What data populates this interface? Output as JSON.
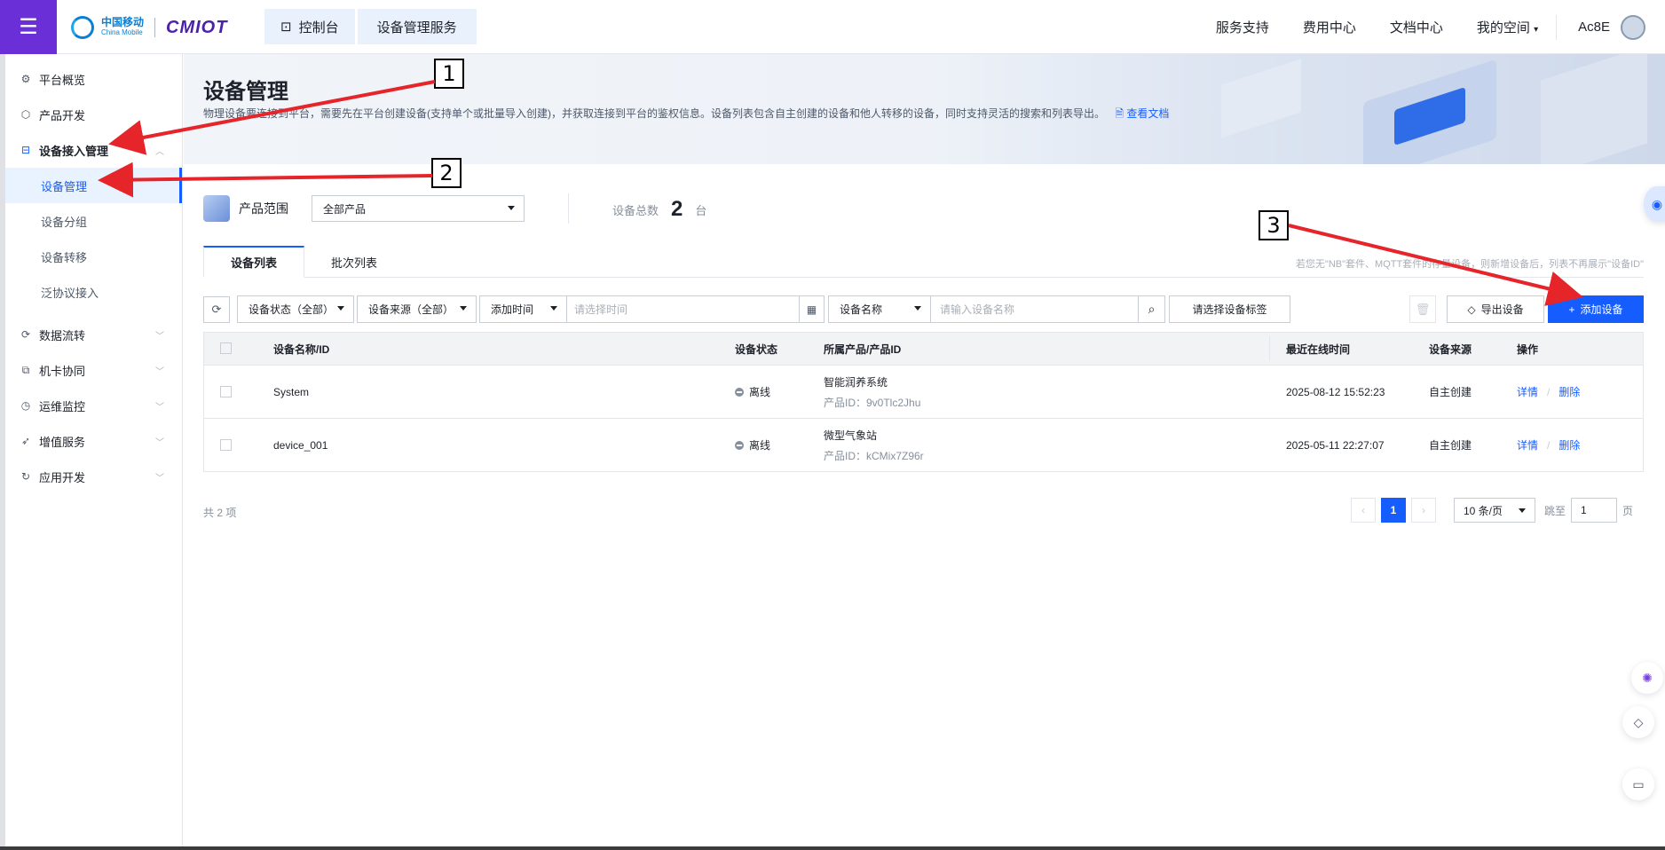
{
  "topbar": {
    "menu_icon": "menu-icon",
    "logo": {
      "brand_cn": "中国移动",
      "brand_en": "China Mobile",
      "product": "CMIOT"
    },
    "breadcrumbs": [
      "控制台",
      "设备管理服务"
    ],
    "links": [
      "服务支持",
      "费用中心",
      "文档中心",
      "我的空间"
    ],
    "user_name": "Ac8E"
  },
  "sidebar": {
    "items": [
      {
        "label": "平台概览",
        "icon": "overview-icon"
      },
      {
        "label": "产品开发",
        "icon": "cube-icon"
      },
      {
        "label": "设备接入管理",
        "icon": "device-access-icon"
      }
    ],
    "sub_items": [
      "设备管理",
      "设备分组",
      "设备转移",
      "泛协议接入"
    ],
    "groups": [
      {
        "label": "数据流转",
        "icon": "data-flow-icon"
      },
      {
        "label": "机卡协同",
        "icon": "sim-icon"
      },
      {
        "label": "运维监控",
        "icon": "monitor-icon"
      },
      {
        "label": "增值服务",
        "icon": "value-added-icon"
      },
      {
        "label": "应用开发",
        "icon": "app-dev-icon"
      }
    ]
  },
  "main": {
    "title": "设备管理",
    "description": "物理设备要连接到平台，需要先在平台创建设备(支持单个或批量导入创建)，并获取连接到平台的鉴权信息。设备列表包含自主创建的设备和他人转移的设备，同时支持灵活的搜索和列表导出。",
    "doc_link": "查看文档",
    "scope_label": "产品范围",
    "scope_value": "全部产品",
    "count_label": "设备总数",
    "count_value": "2",
    "count_unit": "台",
    "tabs": [
      "设备列表",
      "批次列表"
    ],
    "tab_hint": "若您无\"NB\"套件、MQTT套件的存量设备，则新增设备后，列表不再展示\"设备ID\"",
    "filters": {
      "status": "设备状态（全部）",
      "source": "设备来源（全部）",
      "time_type": "添加时间",
      "time_placeholder": "请选择时间",
      "name_type": "设备名称",
      "name_placeholder": "请输入设备名称",
      "tag_button": "请选择设备标签",
      "export_button": "导出设备",
      "add_button": "添加设备"
    },
    "table": {
      "columns": [
        "设备名称/ID",
        "设备状态",
        "所属产品/产品ID",
        "最近在线时间",
        "设备来源",
        "操作"
      ],
      "rows": [
        {
          "name": "System",
          "status": "离线",
          "product": "智能润养系统",
          "product_id": "产品ID：9v0Tlc2Jhu",
          "last_online": "2025-08-12 15:52:23",
          "source": "自主创建",
          "detail": "详情",
          "delete": "删除"
        },
        {
          "name": "device_001",
          "status": "离线",
          "product": "微型气象站",
          "product_id": "产品ID：kCMix7Z96r",
          "last_online": "2025-05-11 22:27:07",
          "source": "自主创建",
          "detail": "详情",
          "delete": "删除"
        }
      ],
      "op_separator": "/"
    },
    "pagination": {
      "total": "共 2 项",
      "current": "1",
      "page_size": "10 条/页",
      "jump_label": "跳至",
      "jump_value": "1",
      "jump_unit": "页"
    }
  },
  "annotations": [
    "1",
    "2",
    "3"
  ],
  "colors": {
    "accent": "#165dff",
    "brand_purple": "#6a2fd6",
    "arrow": "#e5252a"
  }
}
